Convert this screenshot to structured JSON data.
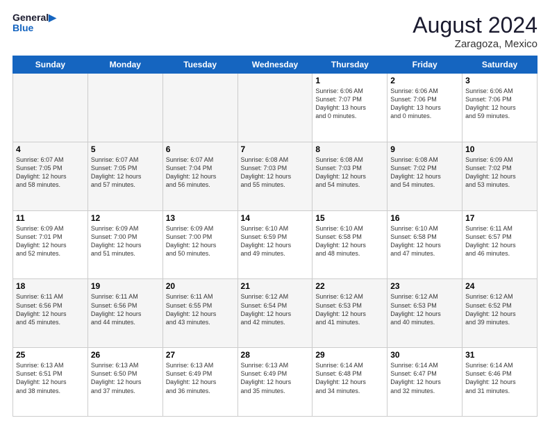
{
  "logo": {
    "line1": "General",
    "line2": "Blue"
  },
  "title": "August 2024",
  "subtitle": "Zaragoza, Mexico",
  "days": [
    "Sunday",
    "Monday",
    "Tuesday",
    "Wednesday",
    "Thursday",
    "Friday",
    "Saturday"
  ],
  "weeks": [
    [
      {
        "day": "",
        "text": ""
      },
      {
        "day": "",
        "text": ""
      },
      {
        "day": "",
        "text": ""
      },
      {
        "day": "",
        "text": ""
      },
      {
        "day": "1",
        "text": "Sunrise: 6:06 AM\nSunset: 7:07 PM\nDaylight: 13 hours\nand 0 minutes."
      },
      {
        "day": "2",
        "text": "Sunrise: 6:06 AM\nSunset: 7:06 PM\nDaylight: 13 hours\nand 0 minutes."
      },
      {
        "day": "3",
        "text": "Sunrise: 6:06 AM\nSunset: 7:06 PM\nDaylight: 12 hours\nand 59 minutes."
      }
    ],
    [
      {
        "day": "4",
        "text": "Sunrise: 6:07 AM\nSunset: 7:05 PM\nDaylight: 12 hours\nand 58 minutes."
      },
      {
        "day": "5",
        "text": "Sunrise: 6:07 AM\nSunset: 7:05 PM\nDaylight: 12 hours\nand 57 minutes."
      },
      {
        "day": "6",
        "text": "Sunrise: 6:07 AM\nSunset: 7:04 PM\nDaylight: 12 hours\nand 56 minutes."
      },
      {
        "day": "7",
        "text": "Sunrise: 6:08 AM\nSunset: 7:03 PM\nDaylight: 12 hours\nand 55 minutes."
      },
      {
        "day": "8",
        "text": "Sunrise: 6:08 AM\nSunset: 7:03 PM\nDaylight: 12 hours\nand 54 minutes."
      },
      {
        "day": "9",
        "text": "Sunrise: 6:08 AM\nSunset: 7:02 PM\nDaylight: 12 hours\nand 54 minutes."
      },
      {
        "day": "10",
        "text": "Sunrise: 6:09 AM\nSunset: 7:02 PM\nDaylight: 12 hours\nand 53 minutes."
      }
    ],
    [
      {
        "day": "11",
        "text": "Sunrise: 6:09 AM\nSunset: 7:01 PM\nDaylight: 12 hours\nand 52 minutes."
      },
      {
        "day": "12",
        "text": "Sunrise: 6:09 AM\nSunset: 7:00 PM\nDaylight: 12 hours\nand 51 minutes."
      },
      {
        "day": "13",
        "text": "Sunrise: 6:09 AM\nSunset: 7:00 PM\nDaylight: 12 hours\nand 50 minutes."
      },
      {
        "day": "14",
        "text": "Sunrise: 6:10 AM\nSunset: 6:59 PM\nDaylight: 12 hours\nand 49 minutes."
      },
      {
        "day": "15",
        "text": "Sunrise: 6:10 AM\nSunset: 6:58 PM\nDaylight: 12 hours\nand 48 minutes."
      },
      {
        "day": "16",
        "text": "Sunrise: 6:10 AM\nSunset: 6:58 PM\nDaylight: 12 hours\nand 47 minutes."
      },
      {
        "day": "17",
        "text": "Sunrise: 6:11 AM\nSunset: 6:57 PM\nDaylight: 12 hours\nand 46 minutes."
      }
    ],
    [
      {
        "day": "18",
        "text": "Sunrise: 6:11 AM\nSunset: 6:56 PM\nDaylight: 12 hours\nand 45 minutes."
      },
      {
        "day": "19",
        "text": "Sunrise: 6:11 AM\nSunset: 6:56 PM\nDaylight: 12 hours\nand 44 minutes."
      },
      {
        "day": "20",
        "text": "Sunrise: 6:11 AM\nSunset: 6:55 PM\nDaylight: 12 hours\nand 43 minutes."
      },
      {
        "day": "21",
        "text": "Sunrise: 6:12 AM\nSunset: 6:54 PM\nDaylight: 12 hours\nand 42 minutes."
      },
      {
        "day": "22",
        "text": "Sunrise: 6:12 AM\nSunset: 6:53 PM\nDaylight: 12 hours\nand 41 minutes."
      },
      {
        "day": "23",
        "text": "Sunrise: 6:12 AM\nSunset: 6:53 PM\nDaylight: 12 hours\nand 40 minutes."
      },
      {
        "day": "24",
        "text": "Sunrise: 6:12 AM\nSunset: 6:52 PM\nDaylight: 12 hours\nand 39 minutes."
      }
    ],
    [
      {
        "day": "25",
        "text": "Sunrise: 6:13 AM\nSunset: 6:51 PM\nDaylight: 12 hours\nand 38 minutes."
      },
      {
        "day": "26",
        "text": "Sunrise: 6:13 AM\nSunset: 6:50 PM\nDaylight: 12 hours\nand 37 minutes."
      },
      {
        "day": "27",
        "text": "Sunrise: 6:13 AM\nSunset: 6:49 PM\nDaylight: 12 hours\nand 36 minutes."
      },
      {
        "day": "28",
        "text": "Sunrise: 6:13 AM\nSunset: 6:49 PM\nDaylight: 12 hours\nand 35 minutes."
      },
      {
        "day": "29",
        "text": "Sunrise: 6:14 AM\nSunset: 6:48 PM\nDaylight: 12 hours\nand 34 minutes."
      },
      {
        "day": "30",
        "text": "Sunrise: 6:14 AM\nSunset: 6:47 PM\nDaylight: 12 hours\nand 32 minutes."
      },
      {
        "day": "31",
        "text": "Sunrise: 6:14 AM\nSunset: 6:46 PM\nDaylight: 12 hours\nand 31 minutes."
      }
    ]
  ]
}
